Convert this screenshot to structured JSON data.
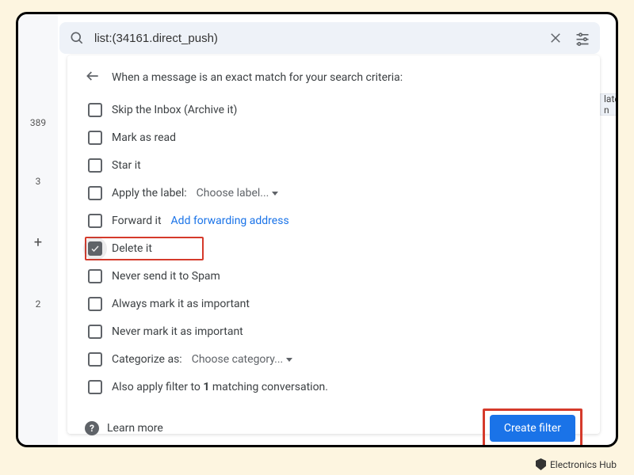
{
  "search": {
    "query": "list:(34161.direct_push)"
  },
  "sidebar": {
    "count_top": "389",
    "count_mid": "3",
    "plus": "+",
    "count_bot": "2"
  },
  "header": "When a message is an exact match for your search criteria:",
  "options": {
    "skip_inbox": "Skip the Inbox (Archive it)",
    "mark_read": "Mark as read",
    "star": "Star it",
    "apply_label_prefix": "Apply the label:",
    "apply_label_choice": "Choose label...",
    "forward": "Forward it",
    "forward_link": "Add forwarding address",
    "delete": "Delete it",
    "never_spam": "Never send it to Spam",
    "always_important": "Always mark it as important",
    "never_important": "Never mark it as important",
    "categorize_prefix": "Categorize as:",
    "categorize_choice": "Choose category...",
    "also_apply_pre": "Also apply filter to ",
    "also_apply_bold": "1",
    "also_apply_post": " matching conversation."
  },
  "footer": {
    "learn_more": "Learn more",
    "create_filter": "Create filter"
  },
  "peek": "latest n",
  "watermark": "Electronics Hub"
}
